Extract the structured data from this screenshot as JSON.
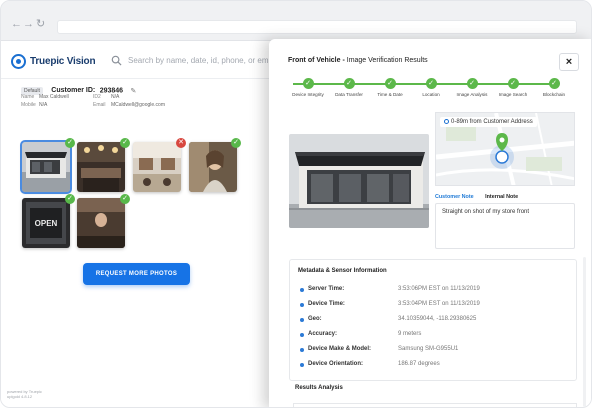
{
  "app": {
    "logo_text": "Truepic Vision",
    "search_placeholder": "Search by name, date, id, phone, or em"
  },
  "customer": {
    "badge": "Default",
    "id_label": "Customer ID:",
    "id": "293846",
    "fields": [
      {
        "k": "Name",
        "v": "Max Caldwell",
        "k2": "ID2",
        "v2": "N/A"
      },
      {
        "k": "Mobile",
        "v": "N/A",
        "k2": "Email",
        "v2": "MCaldwell@google.com"
      }
    ]
  },
  "photos": [
    {
      "scene": "storefront",
      "status": "ok",
      "selected": true
    },
    {
      "scene": "cafe-interior",
      "status": "ok"
    },
    {
      "scene": "restaurant-tables",
      "status": "bad"
    },
    {
      "scene": "woman-portrait",
      "status": "ok"
    },
    {
      "scene": "open-sign",
      "status": "ok"
    },
    {
      "scene": "person-counter",
      "status": "ok"
    }
  ],
  "request_button": "REQUEST MORE PHOTOS",
  "footer": {
    "line1": "powered by Truepic",
    "line2": "uplgold 4.8.12"
  },
  "panel": {
    "title_bold": "Front of Vehicle -",
    "title_rest": "Image Verification Results",
    "close": "×",
    "steps": [
      "Device Integrity",
      "Data Transfer",
      "Time & Date",
      "Location",
      "Image Analysis",
      "Image Search",
      "Blockchain"
    ],
    "map_badge": "0-89m from Customer Address",
    "note_tabs": [
      "Customer Note",
      "Internal Note"
    ],
    "note_text": "Straight on shot of my store front",
    "metadata_title": "Metadata & Sensor Information",
    "metadata": [
      {
        "k": "Server Time:",
        "v": "3:53:06PM EST on 11/13/2019"
      },
      {
        "k": "Device Time:",
        "v": "3:53:04PM EST on 11/13/2019"
      },
      {
        "k": "Geo:",
        "v": "34.10359044, -118.29380625"
      },
      {
        "k": "Accuracy:",
        "v": "9 meters"
      },
      {
        "k": "Device Make & Model:",
        "v": "Samsung SM-G955U1"
      },
      {
        "k": "Device Orientation:",
        "v": "186.87 degrees"
      }
    ],
    "results_title": "Results Analysis"
  },
  "colors": {
    "accent": "#1673e6",
    "success": "#58b84a",
    "error": "#d8473f",
    "link": "#1f7ad6"
  }
}
